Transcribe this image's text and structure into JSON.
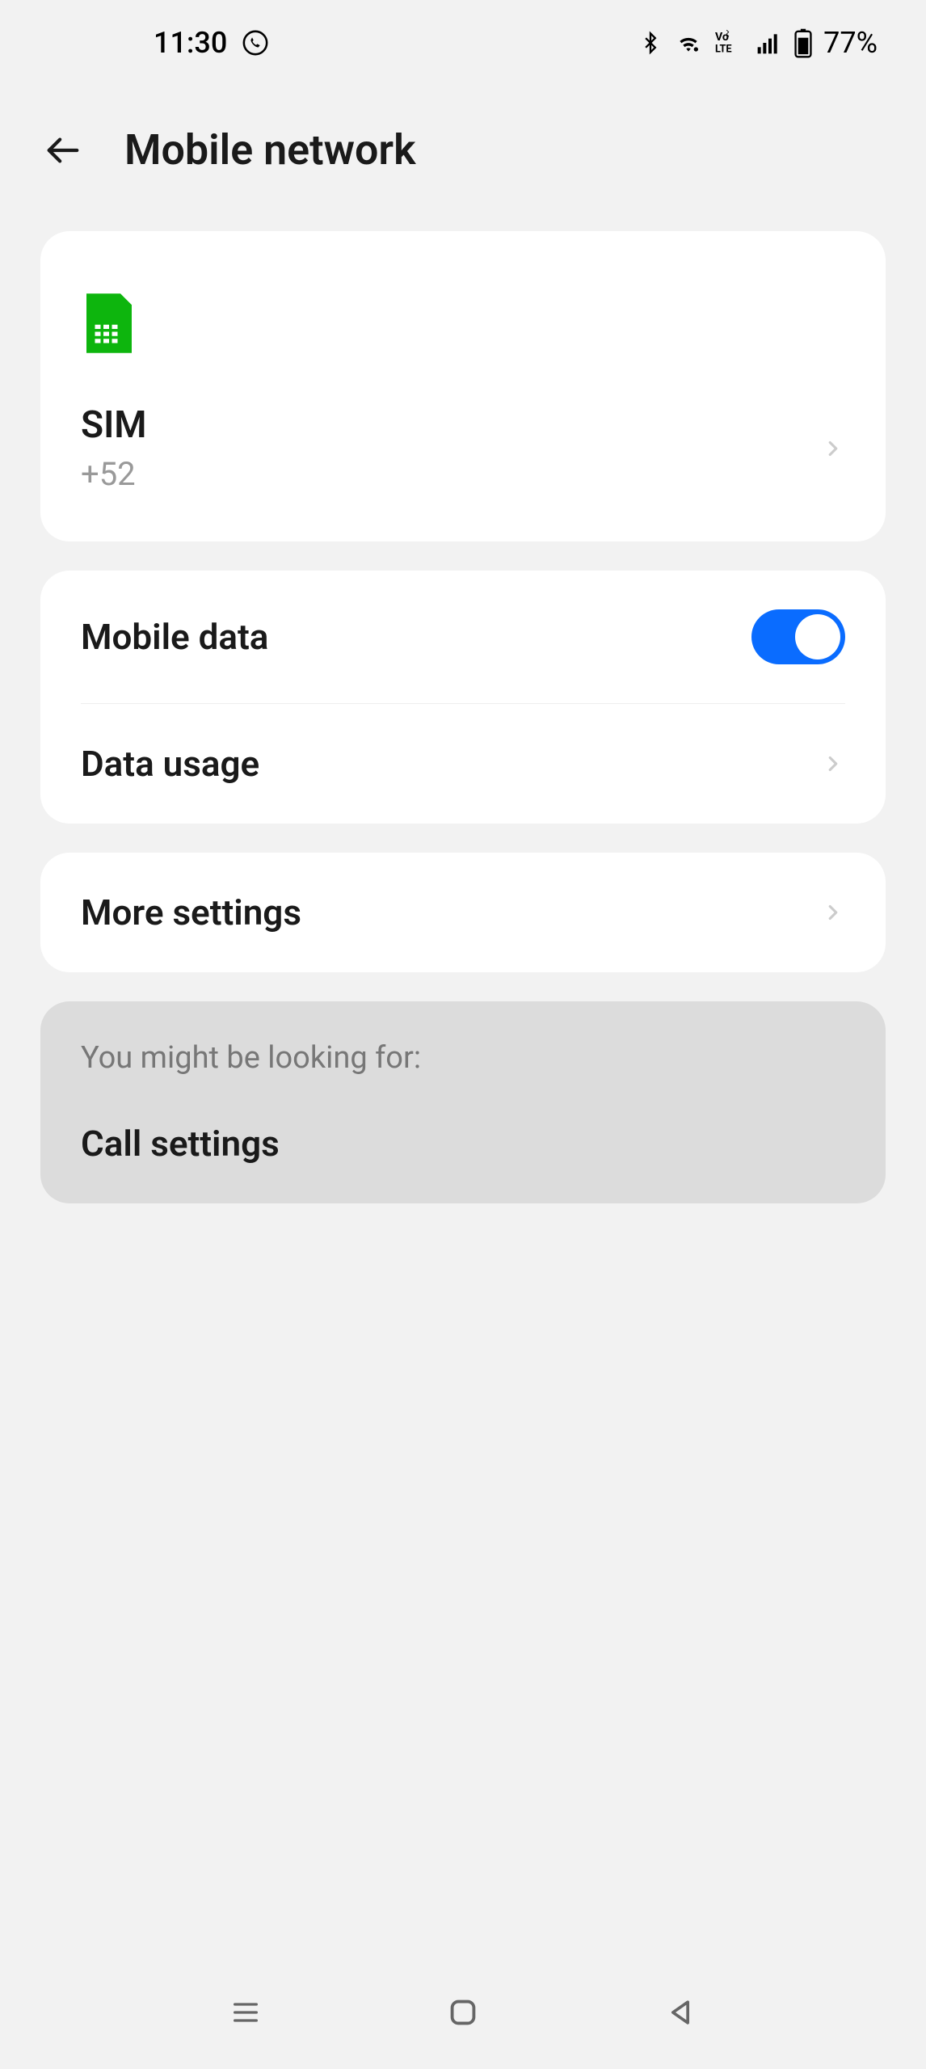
{
  "status_bar": {
    "time": "11:30",
    "battery": "77%"
  },
  "header": {
    "title": "Mobile network"
  },
  "sim": {
    "label": "SIM",
    "number": "+52"
  },
  "settings": {
    "mobile_data_label": "Mobile data",
    "mobile_data_on": true,
    "data_usage_label": "Data usage",
    "more_settings_label": "More settings"
  },
  "suggestion": {
    "hint": "You might be looking for:",
    "item": "Call settings"
  }
}
